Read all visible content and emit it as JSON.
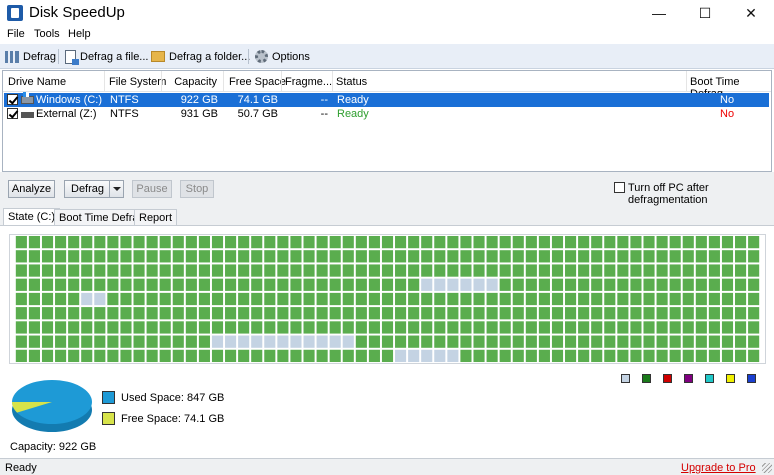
{
  "window": {
    "title": "Disk SpeedUp",
    "minimize": "—",
    "maximize": "☐",
    "close": "✕"
  },
  "menu": [
    "File",
    "Tools",
    "Help"
  ],
  "toolbar": {
    "defrag": "Defrag",
    "defrag_file": "Defrag a file...",
    "defrag_folder": "Defrag a folder...",
    "options": "Options"
  },
  "columns": [
    "Drive Name",
    "File System",
    "Capacity",
    "Free Space",
    "Fragme...",
    "Status",
    "Boot Time Defrag"
  ],
  "drives": [
    {
      "name": "Windows (C:)",
      "fs": "NTFS",
      "capacity": "922 GB",
      "free": "74.1 GB",
      "frag": "--",
      "status": "Ready",
      "boot": "No",
      "selected": true,
      "checked": true
    },
    {
      "name": "External (Z:)",
      "fs": "NTFS",
      "capacity": "931 GB",
      "free": "50.7 GB",
      "frag": "--",
      "status": "Ready",
      "boot": "No",
      "selected": false,
      "checked": true
    }
  ],
  "actions": {
    "analyze": "Analyze",
    "defrag": "Defrag",
    "pause": "Pause",
    "stop": "Stop",
    "turn_off": "Turn off PC after defragmentation",
    "turn_off_checked": false
  },
  "tabs": [
    {
      "label": "State (C:)",
      "active": true
    },
    {
      "label": "Boot Time Defrag",
      "active": false
    },
    {
      "label": "Report",
      "active": false
    }
  ],
  "block_map": {
    "cols": 57,
    "rows": 9,
    "used_color": "#5aad4e",
    "free_color": "#c4d3e3",
    "free_runs": [
      {
        "row": 3,
        "start": 31,
        "length": 6
      },
      {
        "row": 4,
        "start": 5,
        "length": 2
      },
      {
        "row": 7,
        "start": 15,
        "length": 11
      },
      {
        "row": 8,
        "start": 29,
        "length": 1
      },
      {
        "row": 8,
        "start": 30,
        "length": 1
      },
      {
        "row": 8,
        "start": 31,
        "length": 3
      }
    ]
  },
  "legend_colors": [
    "#c4d3e3",
    "#1a7a1a",
    "#d00000",
    "#800080",
    "#20c8c8",
    "#f0f000",
    "#1a3fd0"
  ],
  "disk_space": {
    "used_label": "Used Space: 847 GB",
    "free_label": "Free Space: 74.1 GB",
    "used_value": 847,
    "free_value": 74.1,
    "used_color": "#1e9ad6",
    "free_color": "#d7e34a",
    "capacity_label": "Capacity: 922 GB"
  },
  "status": {
    "text": "Ready",
    "upgrade": "Upgrade to Pro"
  }
}
